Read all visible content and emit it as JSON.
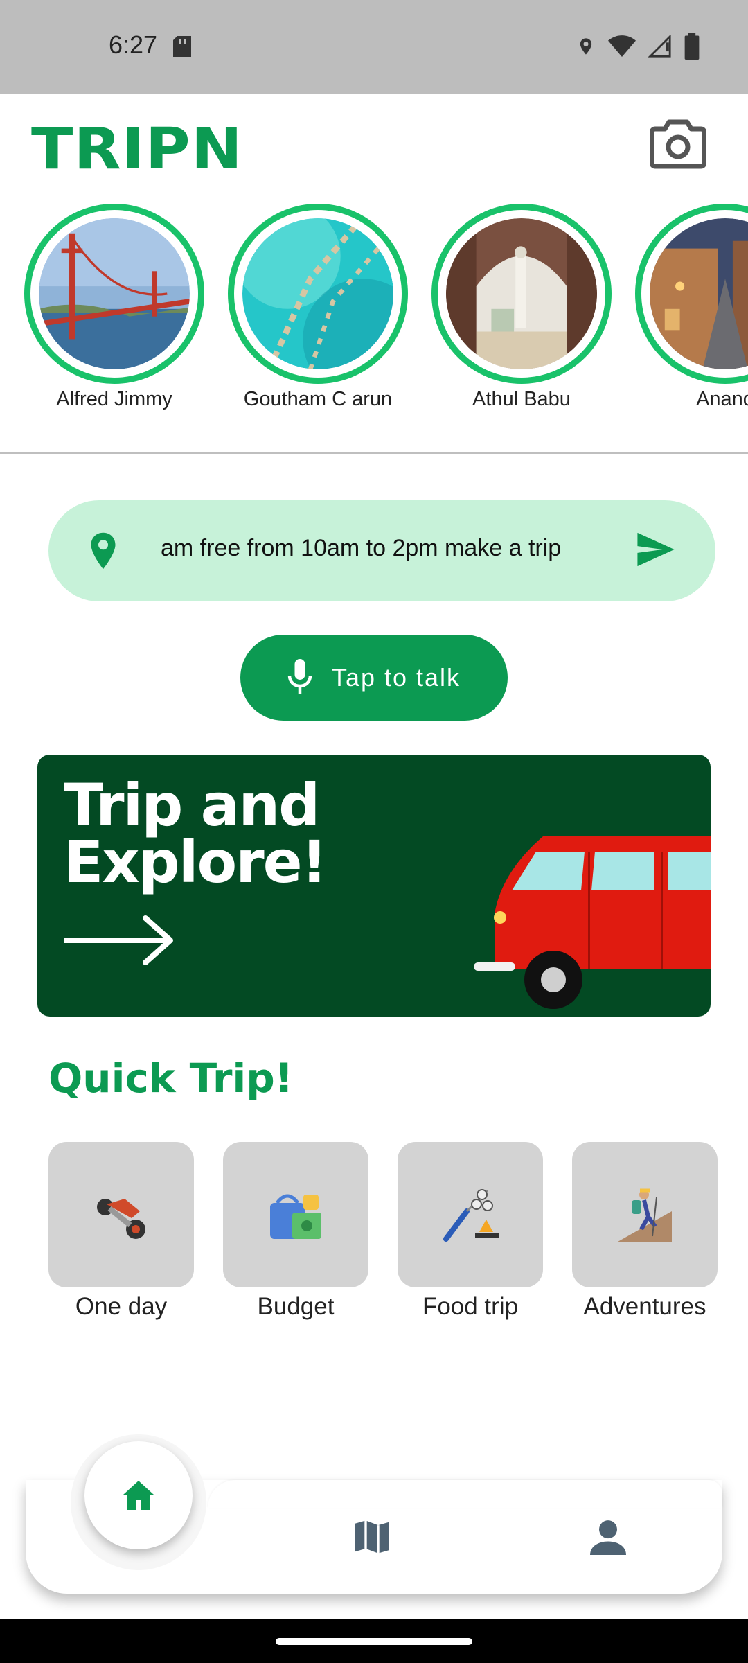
{
  "status_bar": {
    "time": "6:27"
  },
  "header": {
    "brand": "TRIPN",
    "camera_icon": "camera-icon"
  },
  "stories": [
    {
      "name": "Alfred Jimmy",
      "image": "golden-gate-bridge"
    },
    {
      "name": "Goutham C arun",
      "image": "maldives-water-villas"
    },
    {
      "name": "Athul Babu",
      "image": "archway-minaret"
    },
    {
      "name": "Anand",
      "image": "old-town-street"
    }
  ],
  "prompt": {
    "text": "am free from 10am to 2pm make a trip",
    "left_icon": "location-pin-icon",
    "right_icon": "send-icon"
  },
  "talk_button": {
    "label": "Tap to talk",
    "icon": "microphone-icon"
  },
  "banner": {
    "title_line1": "Trip and",
    "title_line2": "Explore!",
    "icon": "arrow-right-icon"
  },
  "quick_trip": {
    "title": "Quick Trip!",
    "items": [
      {
        "label": "One day",
        "icon": "scooter-icon"
      },
      {
        "label": "Budget",
        "icon": "wallet-cash-icon"
      },
      {
        "label": "Food trip",
        "icon": "grill-icon"
      },
      {
        "label": "Adventures",
        "icon": "hiker-icon"
      }
    ]
  },
  "bottom_nav": {
    "items": [
      "home-icon",
      "map-icon",
      "person-icon"
    ]
  },
  "colors": {
    "brand": "#0c9a52",
    "ring": "#19c26a",
    "prompt_bg": "#c7f2d9",
    "banner_bg": "#034a23"
  }
}
